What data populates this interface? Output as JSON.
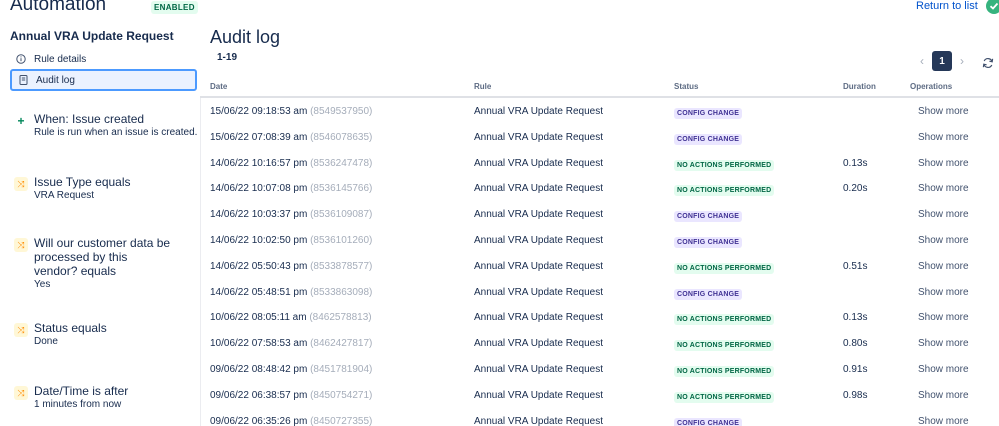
{
  "header": {
    "app_title": "Automation",
    "enabled_badge": "ENABLED",
    "return_link": "Return to list"
  },
  "sidebar": {
    "rule_name": "Annual VRA Update Request",
    "nav": [
      {
        "label": "Rule details",
        "icon": "info-icon"
      },
      {
        "label": "Audit log",
        "icon": "document-icon",
        "active": true
      }
    ],
    "components": [
      {
        "title": "When: Issue created",
        "subtitle": "Rule is run when an issue is created.",
        "icon": "trigger-plus-icon"
      },
      {
        "title": "Issue Type equals",
        "subtitle": "VRA Request",
        "icon": "condition-icon"
      },
      {
        "title": "Will our customer data be processed by this vendor? equals",
        "subtitle": "Yes",
        "icon": "condition-icon"
      },
      {
        "title": "Status equals",
        "subtitle": "Done",
        "icon": "condition-icon"
      },
      {
        "title": "Date/Time is after",
        "subtitle": "1 minutes from now",
        "icon": "condition-icon"
      }
    ]
  },
  "main": {
    "title": "Audit log",
    "range": "1-19",
    "current_page": "1",
    "columns": {
      "date": "Date",
      "rule": "Rule",
      "status": "Status",
      "duration": "Duration",
      "operations": "Operations"
    },
    "rows": [
      {
        "date": "15/06/22 09:18:53 am",
        "id": "(8549537950)",
        "rule": "Annual VRA Update Request",
        "status": "CONFIG CHANGE",
        "duration": "",
        "ops": "Show more"
      },
      {
        "date": "15/06/22 07:08:39 am",
        "id": "(8546078635)",
        "rule": "Annual VRA Update Request",
        "status": "CONFIG CHANGE",
        "duration": "",
        "ops": "Show more"
      },
      {
        "date": "14/06/22 10:16:57 pm",
        "id": "(8536247478)",
        "rule": "Annual VRA Update Request",
        "status": "NO ACTIONS PERFORMED",
        "duration": "0.13s",
        "ops": "Show more"
      },
      {
        "date": "14/06/22 10:07:08 pm",
        "id": "(8536145766)",
        "rule": "Annual VRA Update Request",
        "status": "NO ACTIONS PERFORMED",
        "duration": "0.20s",
        "ops": "Show more"
      },
      {
        "date": "14/06/22 10:03:37 pm",
        "id": "(8536109087)",
        "rule": "Annual VRA Update Request",
        "status": "CONFIG CHANGE",
        "duration": "",
        "ops": "Show more"
      },
      {
        "date": "14/06/22 10:02:50 pm",
        "id": "(8536101260)",
        "rule": "Annual VRA Update Request",
        "status": "CONFIG CHANGE",
        "duration": "",
        "ops": "Show more"
      },
      {
        "date": "14/06/22 05:50:43 pm",
        "id": "(8533878577)",
        "rule": "Annual VRA Update Request",
        "status": "NO ACTIONS PERFORMED",
        "duration": "0.51s",
        "ops": "Show more"
      },
      {
        "date": "14/06/22 05:48:51 pm",
        "id": "(8533863098)",
        "rule": "Annual VRA Update Request",
        "status": "CONFIG CHANGE",
        "duration": "",
        "ops": "Show more"
      },
      {
        "date": "10/06/22 08:05:11 am",
        "id": "(8462578813)",
        "rule": "Annual VRA Update Request",
        "status": "NO ACTIONS PERFORMED",
        "duration": "0.13s",
        "ops": "Show more"
      },
      {
        "date": "10/06/22 07:58:53 am",
        "id": "(8462427817)",
        "rule": "Annual VRA Update Request",
        "status": "NO ACTIONS PERFORMED",
        "duration": "0.80s",
        "ops": "Show more"
      },
      {
        "date": "09/06/22 08:48:42 pm",
        "id": "(8451781904)",
        "rule": "Annual VRA Update Request",
        "status": "NO ACTIONS PERFORMED",
        "duration": "0.91s",
        "ops": "Show more"
      },
      {
        "date": "09/06/22 06:38:57 pm",
        "id": "(8450754271)",
        "rule": "Annual VRA Update Request",
        "status": "NO ACTIONS PERFORMED",
        "duration": "0.98s",
        "ops": "Show more"
      },
      {
        "date": "09/06/22 06:35:26 pm",
        "id": "(8450727355)",
        "rule": "Annual VRA Update Request",
        "status": "CONFIG CHANGE",
        "duration": "",
        "ops": "Show more"
      }
    ]
  }
}
